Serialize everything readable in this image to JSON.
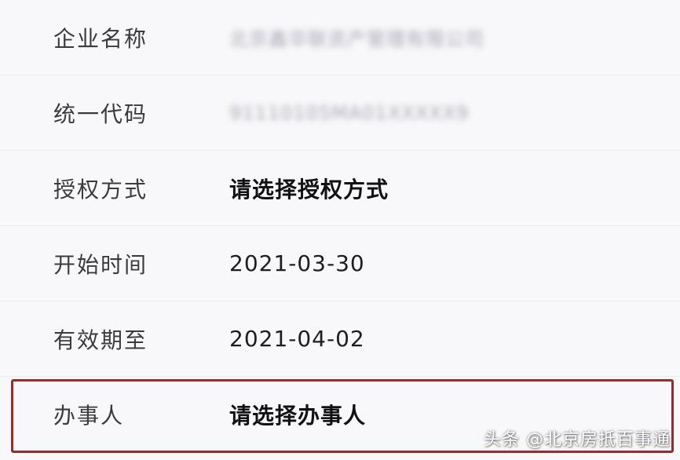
{
  "form": {
    "rows": [
      {
        "label": "企业名称",
        "value": "北京鑫华联资产管理有限公司"
      },
      {
        "label": "统一代码",
        "value": "91110105MA01XXXXX9"
      },
      {
        "label": "授权方式",
        "value": "请选择授权方式"
      },
      {
        "label": "开始时间",
        "value": "2021-03-30"
      },
      {
        "label": "有效期至",
        "value": "2021-04-02"
      },
      {
        "label": "办事人",
        "value": "请选择办事人"
      }
    ]
  },
  "watermark": "头条 @北京房抵百事通",
  "colors": {
    "background": "#f8f8fa",
    "highlight_border": "#9b2a2a",
    "label_text": "#3b3b3b",
    "value_text": "#1e1e1e"
  }
}
